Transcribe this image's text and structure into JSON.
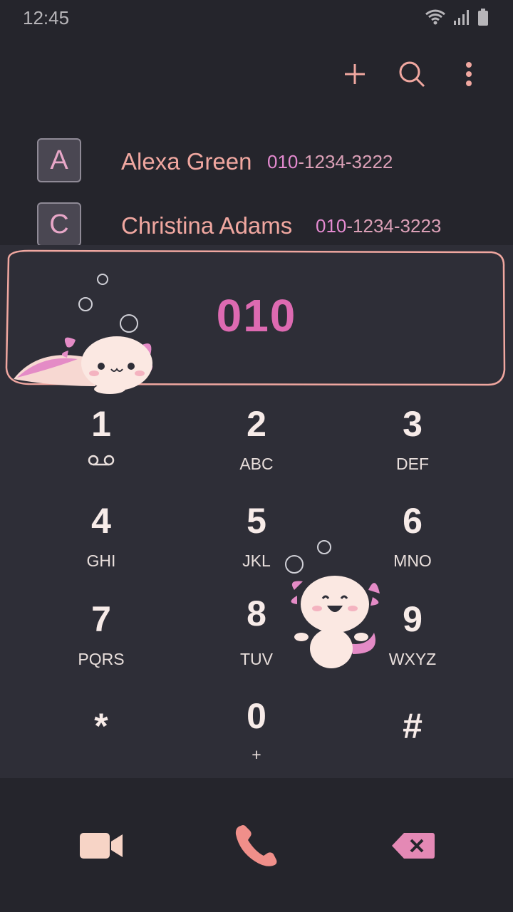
{
  "status_bar": {
    "time": "12:45"
  },
  "toolbar": {
    "add": "add-icon",
    "search": "search-icon",
    "more": "more-vertical-icon"
  },
  "contacts": [
    {
      "letter": "A",
      "name": "Alexa Green",
      "number_match": "010",
      "number_rest": "-1234-3222"
    },
    {
      "letter": "C",
      "name": "Christina Adams",
      "number_match": "010",
      "number_rest": "-1234-3223"
    }
  ],
  "dialer": {
    "entered_number": "010",
    "keys": [
      {
        "digit": "1",
        "sub": "",
        "sub_icon": "voicemail-icon"
      },
      {
        "digit": "2",
        "sub": "ABC"
      },
      {
        "digit": "3",
        "sub": "DEF"
      },
      {
        "digit": "4",
        "sub": "GHI"
      },
      {
        "digit": "5",
        "sub": "JKL"
      },
      {
        "digit": "6",
        "sub": "MNO"
      },
      {
        "digit": "7",
        "sub": "PQRS"
      },
      {
        "digit": "8",
        "sub": "TUV"
      },
      {
        "digit": "9",
        "sub": "WXYZ"
      },
      {
        "digit": "*",
        "sub": ""
      },
      {
        "digit": "0",
        "sub": "+"
      },
      {
        "digit": "#",
        "sub": ""
      }
    ]
  },
  "actions": {
    "video_call": "video-call-icon",
    "call": "phone-icon",
    "delete": "backspace-icon"
  },
  "colors": {
    "accent_pink": "#dd6ab1",
    "salmon": "#f0a7a0",
    "background": "#25252c"
  }
}
